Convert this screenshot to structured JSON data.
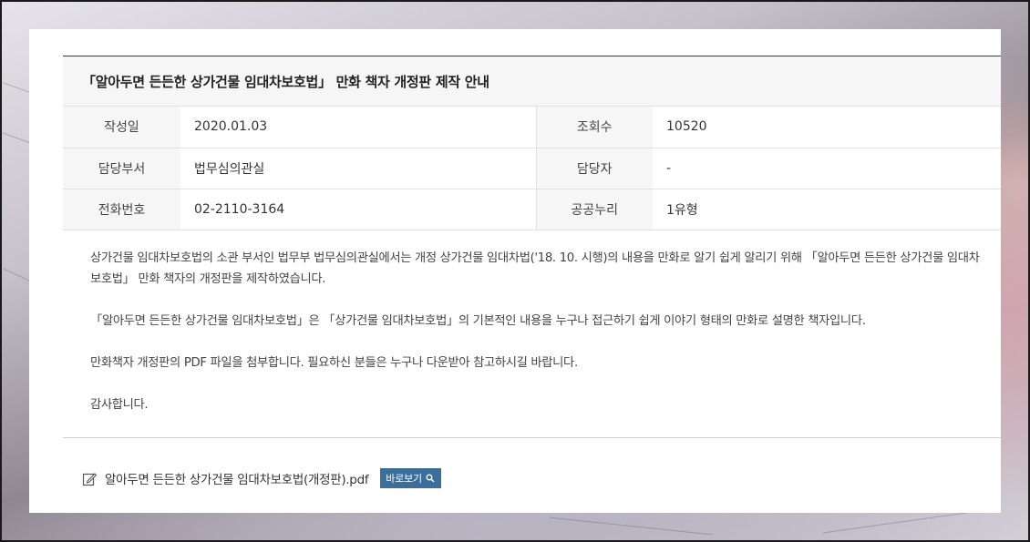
{
  "post": {
    "title": "「알아두면 든든한 상가건물 임대차보호법」 만화 책자 개정판 제작 안내",
    "meta": {
      "date_label": "작성일",
      "date_value": "2020.01.03",
      "views_label": "조회수",
      "views_value": "10520",
      "dept_label": "담당부서",
      "dept_value": "법무심의관실",
      "manager_label": "담당자",
      "manager_value": "-",
      "phone_label": "전화번호",
      "phone_value": "02-2110-3164",
      "license_label": "공공누리",
      "license_value": "1유형"
    },
    "body": [
      "상가건물 임대차보호법의 소관 부서인 법무부 법무심의관실에서는 개정 상가건물 임대차법('18. 10. 시행)의 내용을 만화로 알기 쉽게 알리기 위해 「알아두면 든든한 상가건물 임대차보호법」 만화 책자의 개정판을 제작하였습니다.",
      "「알아두면 든든한 상가건물 임대차보호법」은 「상가건물 임대차보호법」의 기본적인 내용을 누구나 접근하기 쉽게 이야기 형태의 만화로 설명한 책자입니다.",
      "만화책자 개정판의 PDF 파일을 첨부합니다. 필요하신 분들은 누구나 다운받아 참고하시길 바랍니다.",
      "감사합니다."
    ]
  },
  "attachment": {
    "icon": "file-edit-icon",
    "filename": "알아두면 든든한 상가건물 임대차보호법(개정판).pdf",
    "view_label": "바로보기",
    "view_icon": "search-icon"
  },
  "colors": {
    "button_bg": "#3b6e9a",
    "title_bg": "#f6f6f6",
    "border": "#e1e1e1"
  }
}
